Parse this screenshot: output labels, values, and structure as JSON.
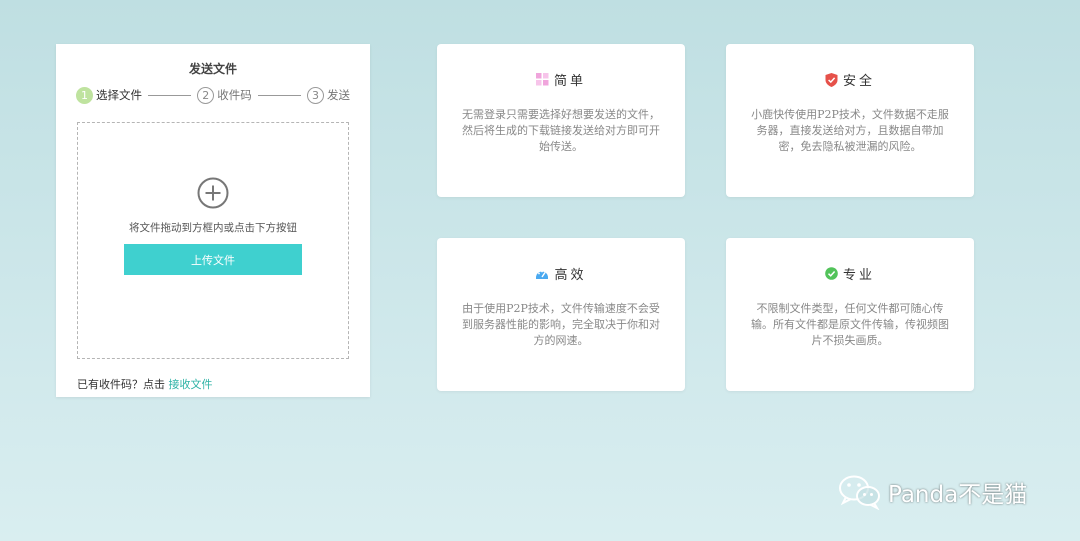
{
  "upload_panel": {
    "title": "发送文件",
    "steps": [
      {
        "num": "1",
        "label": "选择文件"
      },
      {
        "num": "2",
        "label": "收件码"
      },
      {
        "num": "3",
        "label": "发送"
      }
    ],
    "drop_hint": "将文件拖动到方框内或点击下方按钮",
    "upload_button": "上传文件",
    "receive_prefix": "已有收件码？点击",
    "receive_link": "接收文件"
  },
  "features": [
    {
      "title": "简单",
      "icon": "grid-icon",
      "color": "#f0a5dc",
      "desc": "无需登录只需要选择好想要发送的文件，然后将生成的下载链接发送给对方即可开始传送。"
    },
    {
      "title": "安全",
      "icon": "shield-icon",
      "color": "#e6514a",
      "desc": "小鹿快传使用P2P技术，文件数据不走服务器，直接发送给对方，且数据自带加密，免去隐私被泄漏的风险。"
    },
    {
      "title": "高效",
      "icon": "speed-icon",
      "color": "#4aa9f0",
      "desc": "由于使用P2P技术，文件传输速度不会受到服务器性能的影响，完全取决于你和对方的网速。"
    },
    {
      "title": "专业",
      "icon": "check-icon",
      "color": "#52c35a",
      "desc": "不限制文件类型，任何文件都可随心传输。所有文件都是原文件传输，传视频图片不损失画质。"
    }
  ],
  "watermark": {
    "text": "Panda不是猫",
    "icon": "wechat-icon"
  }
}
